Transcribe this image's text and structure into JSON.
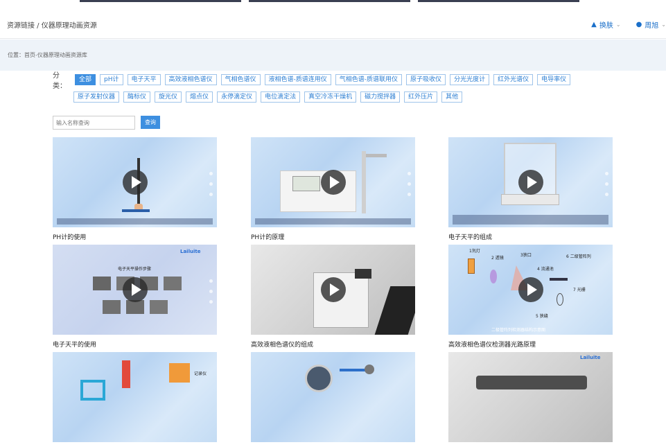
{
  "header": {
    "breadcrumb": "资源链接 / 仪器原理动画资源",
    "skin_label": "换肤",
    "user_label": "周旭"
  },
  "location": {
    "text": "位置：首页-仪器原理动画资源库"
  },
  "filters": {
    "label": "分类：",
    "row1": [
      "全部",
      "pH计",
      "电子天平",
      "高效液相色谱仪",
      "气相色谱仪",
      "液相色谱-质谱连用仪",
      "气相色谱-质谱联用仪",
      "原子吸收仪",
      "分光光度计",
      "红外光谱仪",
      "电导率仪"
    ],
    "row2": [
      "原子发射仪器",
      "酶标仪",
      "旋光仪",
      "熔点仪",
      "永停滴定仪",
      "电位滴定法",
      "真空冷冻干燥机",
      "磁力搅拌器",
      "红外压片",
      "其他"
    ],
    "active": "全部"
  },
  "search": {
    "placeholder": "输入名称查询",
    "button": "查询"
  },
  "cards": [
    {
      "title": "PH计的使用"
    },
    {
      "title": "PH计的原理"
    },
    {
      "title": "电子天平的组成"
    },
    {
      "title": "电子天平的使用"
    },
    {
      "title": "高效液相色谱仪的组成"
    },
    {
      "title": "高效液相色谱仪检测器光路原理"
    },
    {
      "title": ""
    },
    {
      "title": ""
    },
    {
      "title": ""
    }
  ],
  "thumb_text": {
    "balance_title": "电子天平操作步骤",
    "optics_1": "1氘灯",
    "optics_2": "2 透镜",
    "optics_3": "3狭口",
    "optics_4": "4 流通池",
    "optics_5": "5 狭缝",
    "optics_6": "6 二级管阵列",
    "optics_7": "7 光栅",
    "optics_caption": "二极管阵列检测器结构示意图",
    "recorder": "记录仪",
    "logo": "Lailuite"
  }
}
